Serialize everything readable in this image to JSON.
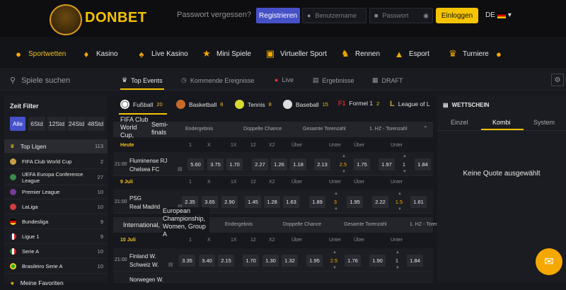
{
  "header": {
    "logo_text": "DONBET",
    "forgot": "Passwort vergessen?",
    "register": "Registrieren",
    "username_placeholder": "Benutzername",
    "password_placeholder": "Passwort",
    "login": "Einloggen",
    "lang": "DE"
  },
  "nav": [
    "Sportwetten",
    "Kasino",
    "Live Kasino",
    "Mini Spiele",
    "Virtueller Sport",
    "Rennen",
    "Esport",
    "Turniere"
  ],
  "subnav": {
    "search": "Spiele suchen",
    "tabs": [
      "Top Events",
      "Kommende Ereignisse",
      "Live",
      "Ergebnisse",
      "DRAFT"
    ]
  },
  "sidebar": {
    "title": "Zeit Filter",
    "filters": [
      "Alle",
      "6Std",
      "12Std",
      "24Std",
      "48Std"
    ],
    "leagues": [
      {
        "name": "Top Ligen",
        "count": "113"
      },
      {
        "name": "FIFA Club World Cup",
        "count": "2"
      },
      {
        "name": "UEFA Europa Conference League",
        "count": "27"
      },
      {
        "name": "Premier League",
        "count": "10"
      },
      {
        "name": "LaLiga",
        "count": "10"
      },
      {
        "name": "Bundesliga",
        "count": "9"
      },
      {
        "name": "Ligue 1",
        "count": "9"
      },
      {
        "name": "Serie A",
        "count": "10"
      },
      {
        "name": "Brasileiro Serie A",
        "count": "10"
      },
      {
        "name": "Meine Favoriten",
        "count": ""
      }
    ]
  },
  "sports": [
    {
      "name": "Fußball",
      "count": "20"
    },
    {
      "name": "Basketball",
      "count": "8"
    },
    {
      "name": "Tennis",
      "count": "8"
    },
    {
      "name": "Baseball",
      "count": "15"
    },
    {
      "name": "Formel 1",
      "count": "2"
    },
    {
      "name": "League of L",
      "count": ""
    }
  ],
  "markets": [
    "Endergebnis",
    "Doppelte Chance",
    "Gesamte Torenzahl",
    "1. HZ - Torenzahl"
  ],
  "cols": [
    "1",
    "X",
    "2",
    "1X",
    "12",
    "X2",
    "Über",
    "Unter",
    "Über",
    "Unter"
  ],
  "comp1": {
    "name": "FIFA Club World Cup,",
    "sub": "Semi-finals",
    "date": "Heute"
  },
  "comp2": {
    "name": "International,",
    "sub": "European Championship, Women, Group A",
    "date": "10 Juli"
  },
  "date_mid": "9 Juli",
  "matches": [
    {
      "time": "21:00",
      "home": "Fluminense RJ",
      "away": "Chelsea FC",
      "odds": [
        "5.60",
        "3.75",
        "1.70",
        "2.27",
        "1.26",
        "1.18",
        "2.13",
        "1.75",
        "1.97",
        "1.84"
      ],
      "line1": "2.5",
      "line2": "1"
    },
    {
      "time": "21:00",
      "home": "PSG",
      "away": "Real Madrid",
      "odds": [
        "2.35",
        "3.65",
        "2.90",
        "1.45",
        "1.28",
        "1.63",
        "1.89",
        "1.95",
        "2.22",
        "1.61"
      ],
      "line1": "3",
      "line2": "1.5"
    },
    {
      "time": "21:00",
      "home": "Finland W.",
      "away": "Schweiz W.",
      "odds": [
        "3.35",
        "3.40",
        "2.15",
        "1.70",
        "1.30",
        "1.32",
        "1.95",
        "1.76",
        "1.90",
        "1.84"
      ],
      "line1": "2.5",
      "line2": "1"
    },
    {
      "time": "",
      "home": "Norwegen W.",
      "away": "",
      "odds": [],
      "line1": "",
      "line2": ""
    }
  ],
  "betslip": {
    "title": "WETTSCHEIN",
    "tabs": [
      "Einzel",
      "Kombi",
      "System"
    ],
    "empty": "Keine Quote ausgewählt"
  }
}
